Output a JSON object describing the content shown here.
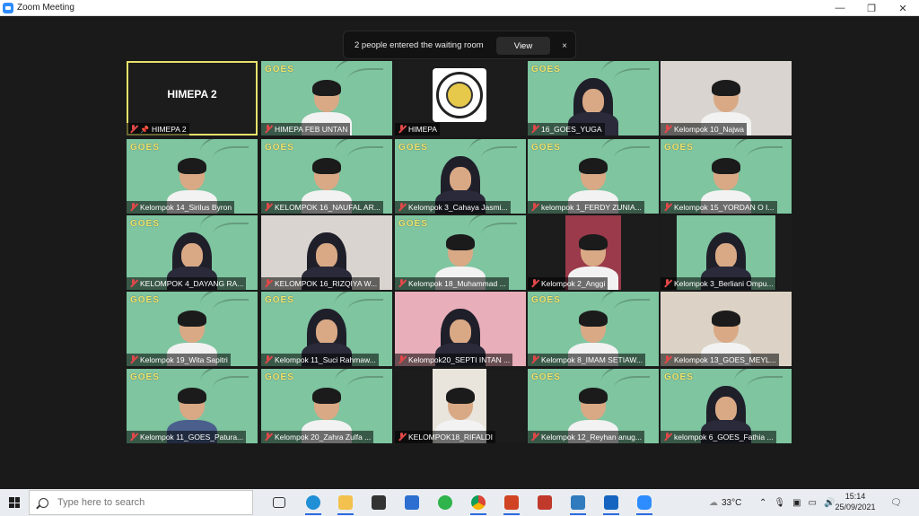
{
  "window": {
    "title": "Zoom Meeting",
    "controls": [
      "—",
      "❐",
      "✕"
    ]
  },
  "notification": {
    "text": "2 people entered the waiting room",
    "button": "View",
    "close": "×"
  },
  "tiles": [
    {
      "name": "HIMEPA 2",
      "display_name": "HIMEPA 2",
      "style": "dark",
      "active": true,
      "pinned": true
    },
    {
      "name": "HIMEPA FEB UNTAN",
      "style": "green"
    },
    {
      "name": "HIMEPA",
      "style": "emblem"
    },
    {
      "name": "16_GOES_YUGA",
      "style": "green"
    },
    {
      "name": "Kelompok 10_Najwa",
      "style": "room"
    },
    {
      "name": "Kelompok 14_Sirilus Byron",
      "style": "green"
    },
    {
      "name": "KELOMPOK 16_NAUFAL AR...",
      "style": "green"
    },
    {
      "name": "Kelompok 3_Cahaya Jasmi...",
      "style": "green"
    },
    {
      "name": "kelompok 1_FERDY ZUNIA...",
      "style": "green"
    },
    {
      "name": "Kelompok 15_YORDAN O I...",
      "style": "green"
    },
    {
      "name": "KELOMPOK 4_DAYANG RA...",
      "style": "green"
    },
    {
      "name": "KELOMPOK 16_RIZQIYA W...",
      "style": "room"
    },
    {
      "name": "Kelompok 18_Muhammad ...",
      "style": "green"
    },
    {
      "name": "Kelompok 2_Anggi",
      "style": "inset"
    },
    {
      "name": "Kelompok 3_Berliani Ompu...",
      "style": "inset-green"
    },
    {
      "name": "Kelompok 19_Wita Sapitri",
      "style": "green"
    },
    {
      "name": "Kelompok 11_Suci Rahmaw...",
      "style": "green"
    },
    {
      "name": "Kelompok20_SEPTI INTAN ...",
      "style": "pink"
    },
    {
      "name": "Kelompok 8_IMAM SETIAW...",
      "style": "green"
    },
    {
      "name": "Kelompok 13_GOES_MEYL...",
      "style": "beige"
    },
    {
      "name": "Kelompok 11_GOES_Patura...",
      "style": "green"
    },
    {
      "name": "Kelompok 20_Zahra Zulfa ...",
      "style": "green"
    },
    {
      "name": "KELOMPOK18_RIFALDI",
      "style": "inset-room"
    },
    {
      "name": "Kelompok 12_Reyhan anug...",
      "style": "green"
    },
    {
      "name": "kelompok 6_GOES_Fathia ...",
      "style": "green"
    }
  ],
  "logo_text": "GOES",
  "taskbar": {
    "search_placeholder": "Type here to search",
    "weather": "33°C",
    "time": "15:14",
    "date": "25/09/2021"
  },
  "colors": {
    "tile_green": "#7ec5a0",
    "meeting_bg": "#1a1a1a",
    "active_outline": "#e6e16a"
  }
}
